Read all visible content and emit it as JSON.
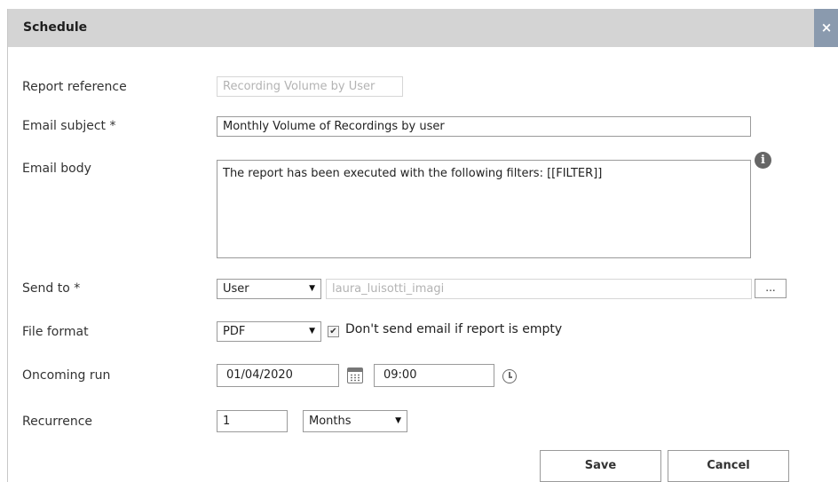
{
  "dialog": {
    "title": "Schedule",
    "close_label": "×"
  },
  "form": {
    "report_reference": {
      "label": "Report reference",
      "value": "Recording Volume by User"
    },
    "email_subject": {
      "label": "Email subject *",
      "value": "Monthly Volume of Recordings by user"
    },
    "email_body": {
      "label": "Email body",
      "value": "The report has been executed with the following filters: [[FILTER]]",
      "info_icon": "i"
    },
    "send_to": {
      "label": "Send to *",
      "type_value": "User",
      "recipient_value": "laura_luisotti_imagi",
      "browse_label": "..."
    },
    "file_format": {
      "label": "File format",
      "value": "PDF",
      "skip_empty_checked": true,
      "skip_empty_label": "Don't send email if report is empty"
    },
    "oncoming_run": {
      "label": "Oncoming run",
      "date_value": "01/04/2020",
      "time_value": "09:00"
    },
    "recurrence": {
      "label": "Recurrence",
      "interval_value": "1",
      "unit_value": "Months"
    }
  },
  "buttons": {
    "save_label": "Save",
    "cancel_label": "Cancel"
  },
  "icons": {
    "select_caret": "▼",
    "checkmark": "✔"
  }
}
